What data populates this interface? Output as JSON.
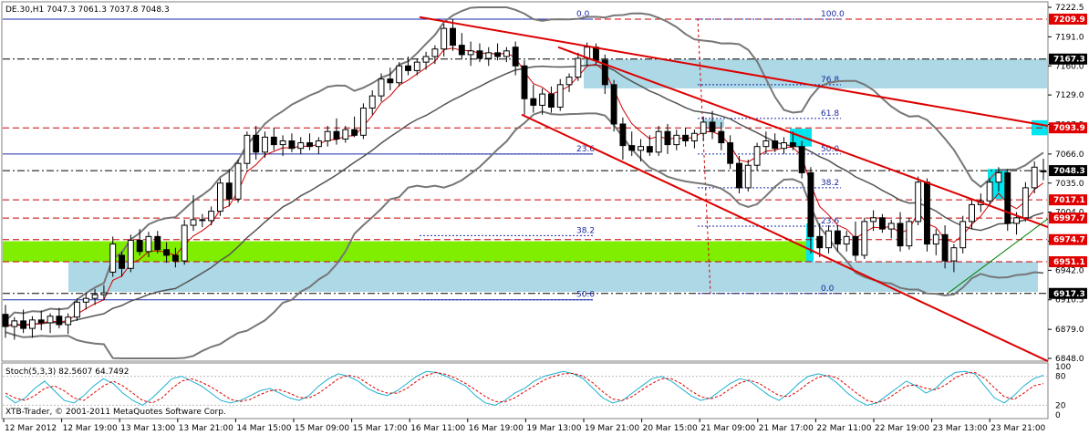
{
  "chart_data": {
    "type": "candlestick",
    "header": "DE.30,H1  7047.3 7061.3 7037.8 7048.3",
    "copyright": "XTB-Trader, © 2001-2011 MetaQuotes Software Corp.",
    "ylim": [
      6848.0,
      7222.5
    ],
    "y_ticks": [
      "7222.5",
      "7191.0",
      "7160.0",
      "7129.0",
      "7097.5",
      "7066.0",
      "7035.0",
      "7004.0",
      "6973.0",
      "6942.0",
      "6910.5",
      "6879.0",
      "6848.0"
    ],
    "x_ticks": [
      "12 Mar 2012",
      "12 Mar 19:00",
      "13 Mar 13:00",
      "13 Mar 21:00",
      "14 Mar 15:00",
      "15 Mar 09:00",
      "15 Mar 17:00",
      "16 Mar 11:00",
      "16 Mar 19:00",
      "19 Mar 13:00",
      "19 Mar 21:00",
      "20 Mar 15:00",
      "21 Mar 09:00",
      "21 Mar 17:00",
      "22 Mar 11:00",
      "22 Mar 19:00",
      "23 Mar 13:00",
      "23 Mar 21:00"
    ],
    "price_tags": [
      {
        "label": "7209.9",
        "value": 7209.9,
        "color": "#e00000"
      },
      {
        "label": "7167.3",
        "value": 7167.3,
        "color": "#000000"
      },
      {
        "label": "7093.9",
        "value": 7093.9,
        "color": "#e00000"
      },
      {
        "label": "7048.3",
        "value": 7048.3,
        "color": "#000000"
      },
      {
        "label": "7017.1",
        "value": 7017.1,
        "color": "#e00000"
      },
      {
        "label": "6997.7",
        "value": 6997.7,
        "color": "#e00000"
      },
      {
        "label": "6974.7",
        "value": 6974.7,
        "color": "#e00000"
      },
      {
        "label": "6951.1",
        "value": 6951.1,
        "color": "#e00000"
      },
      {
        "label": "6917.3",
        "value": 6917.3,
        "color": "#000000"
      }
    ],
    "fib_left": [
      "0.0",
      "23.6",
      "38.2",
      "50.0"
    ],
    "fib_right": [
      "100.0",
      "76.8",
      "61.8",
      "50.0",
      "38.2",
      "23.6",
      "0.0"
    ],
    "stochastic": {
      "label": "Stoch(5,3,3) 82.5607 64.7492",
      "ylim": [
        0,
        100
      ],
      "ticks": [
        "100",
        "80",
        "20",
        "0"
      ],
      "main": [
        40,
        25,
        35,
        55,
        70,
        50,
        30,
        25,
        40,
        60,
        75,
        65,
        45,
        30,
        20,
        35,
        55,
        75,
        80,
        70,
        60,
        45,
        30,
        25,
        30,
        40,
        50,
        55,
        45,
        35,
        30,
        40,
        60,
        75,
        85,
        80,
        70,
        55,
        45,
        40,
        50,
        65,
        80,
        90,
        88,
        80,
        70,
        60,
        40,
        25,
        20,
        30,
        45,
        55,
        70,
        80,
        85,
        90,
        85,
        75,
        55,
        35,
        25,
        30,
        45,
        60,
        75,
        80,
        70,
        55,
        40,
        30,
        35,
        50,
        65,
        75,
        70,
        55,
        40,
        30,
        45,
        65,
        80,
        85,
        80,
        65,
        45,
        30,
        20,
        25,
        40,
        55,
        70,
        60,
        45,
        55,
        75,
        88,
        90,
        85,
        60,
        35,
        25,
        40,
        60,
        75,
        82
      ],
      "signal": [
        45,
        35,
        30,
        40,
        55,
        60,
        50,
        35,
        30,
        45,
        60,
        70,
        60,
        45,
        30,
        25,
        35,
        55,
        70,
        75,
        68,
        58,
        45,
        32,
        28,
        32,
        42,
        50,
        52,
        45,
        36,
        35,
        45,
        60,
        75,
        82,
        78,
        65,
        52,
        45,
        45,
        55,
        70,
        82,
        88,
        84,
        76,
        65,
        52,
        38,
        28,
        27,
        35,
        48,
        60,
        72,
        80,
        85,
        86,
        80,
        66,
        48,
        33,
        30,
        38,
        52,
        65,
        75,
        75,
        65,
        50,
        38,
        33,
        40,
        54,
        66,
        72,
        65,
        52,
        40,
        38,
        50,
        66,
        78,
        82,
        76,
        60,
        44,
        30,
        25,
        32,
        46,
        60,
        62,
        55,
        52,
        62,
        77,
        86,
        88,
        76,
        56,
        38,
        32,
        45,
        60,
        65
      ]
    },
    "candles": [
      {
        "o": 6895,
        "h": 6905,
        "l": 6870,
        "c": 6882
      },
      {
        "o": 6882,
        "h": 6892,
        "l": 6868,
        "c": 6888
      },
      {
        "o": 6888,
        "h": 6900,
        "l": 6875,
        "c": 6880
      },
      {
        "o": 6880,
        "h": 6893,
        "l": 6870,
        "c": 6889
      },
      {
        "o": 6889,
        "h": 6899,
        "l": 6878,
        "c": 6886
      },
      {
        "o": 6886,
        "h": 6896,
        "l": 6875,
        "c": 6893
      },
      {
        "o": 6893,
        "h": 6902,
        "l": 6880,
        "c": 6884
      },
      {
        "o": 6884,
        "h": 6896,
        "l": 6874,
        "c": 6892
      },
      {
        "o": 6892,
        "h": 6912,
        "l": 6888,
        "c": 6908
      },
      {
        "o": 6908,
        "h": 6918,
        "l": 6900,
        "c": 6912
      },
      {
        "o": 6912,
        "h": 6922,
        "l": 6905,
        "c": 6916
      },
      {
        "o": 6916,
        "h": 6926,
        "l": 6910,
        "c": 6918
      },
      {
        "o": 6940,
        "h": 6978,
        "l": 6935,
        "c": 6970
      },
      {
        "o": 6958,
        "h": 6962,
        "l": 6935,
        "c": 6944
      },
      {
        "o": 6944,
        "h": 6980,
        "l": 6940,
        "c": 6974
      },
      {
        "o": 6974,
        "h": 6986,
        "l": 6958,
        "c": 6962
      },
      {
        "o": 6962,
        "h": 6983,
        "l": 6956,
        "c": 6978
      },
      {
        "o": 6978,
        "h": 6984,
        "l": 6960,
        "c": 6964
      },
      {
        "o": 6964,
        "h": 6972,
        "l": 6950,
        "c": 6958
      },
      {
        "o": 6958,
        "h": 6966,
        "l": 6945,
        "c": 6952
      },
      {
        "o": 6952,
        "h": 6996,
        "l": 6948,
        "c": 6990
      },
      {
        "o": 6990,
        "h": 7022,
        "l": 6984,
        "c": 6996
      },
      {
        "o": 6996,
        "h": 7002,
        "l": 6988,
        "c": 6995
      },
      {
        "o": 6995,
        "h": 7010,
        "l": 6990,
        "c": 7005
      },
      {
        "o": 7005,
        "h": 7040,
        "l": 7000,
        "c": 7035
      },
      {
        "o": 7035,
        "h": 7050,
        "l": 7010,
        "c": 7018
      },
      {
        "o": 7018,
        "h": 7060,
        "l": 7014,
        "c": 7056
      },
      {
        "o": 7056,
        "h": 7090,
        "l": 7050,
        "c": 7086
      },
      {
        "o": 7086,
        "h": 7096,
        "l": 7060,
        "c": 7068
      },
      {
        "o": 7068,
        "h": 7090,
        "l": 7062,
        "c": 7084
      },
      {
        "o": 7084,
        "h": 7094,
        "l": 7070,
        "c": 7076
      },
      {
        "o": 7076,
        "h": 7086,
        "l": 7064,
        "c": 7080
      },
      {
        "o": 7080,
        "h": 7088,
        "l": 7068,
        "c": 7072
      },
      {
        "o": 7072,
        "h": 7084,
        "l": 7066,
        "c": 7078
      },
      {
        "o": 7078,
        "h": 7088,
        "l": 7070,
        "c": 7074
      },
      {
        "o": 7074,
        "h": 7084,
        "l": 7066,
        "c": 7080
      },
      {
        "o": 7080,
        "h": 7096,
        "l": 7074,
        "c": 7090
      },
      {
        "o": 7090,
        "h": 7104,
        "l": 7076,
        "c": 7082
      },
      {
        "o": 7082,
        "h": 7096,
        "l": 7078,
        "c": 7092
      },
      {
        "o": 7092,
        "h": 7106,
        "l": 7084,
        "c": 7086
      },
      {
        "o": 7086,
        "h": 7120,
        "l": 7082,
        "c": 7115
      },
      {
        "o": 7115,
        "h": 7134,
        "l": 7108,
        "c": 7128
      },
      {
        "o": 7128,
        "h": 7152,
        "l": 7122,
        "c": 7146
      },
      {
        "o": 7146,
        "h": 7158,
        "l": 7134,
        "c": 7142
      },
      {
        "o": 7142,
        "h": 7164,
        "l": 7138,
        "c": 7160
      },
      {
        "o": 7160,
        "h": 7170,
        "l": 7150,
        "c": 7155
      },
      {
        "o": 7155,
        "h": 7168,
        "l": 7150,
        "c": 7164
      },
      {
        "o": 7164,
        "h": 7175,
        "l": 7156,
        "c": 7170
      },
      {
        "o": 7170,
        "h": 7182,
        "l": 7162,
        "c": 7178
      },
      {
        "o": 7178,
        "h": 7205,
        "l": 7170,
        "c": 7200
      },
      {
        "o": 7200,
        "h": 7210,
        "l": 7176,
        "c": 7182
      },
      {
        "o": 7182,
        "h": 7195,
        "l": 7168,
        "c": 7172
      },
      {
        "o": 7172,
        "h": 7186,
        "l": 7160,
        "c": 7176
      },
      {
        "o": 7176,
        "h": 7184,
        "l": 7164,
        "c": 7168
      },
      {
        "o": 7168,
        "h": 7180,
        "l": 7160,
        "c": 7174
      },
      {
        "o": 7174,
        "h": 7184,
        "l": 7166,
        "c": 7170
      },
      {
        "o": 7170,
        "h": 7180,
        "l": 7164,
        "c": 7176
      },
      {
        "o": 7180,
        "h": 7186,
        "l": 7150,
        "c": 7160
      },
      {
        "o": 7160,
        "h": 7166,
        "l": 7108,
        "c": 7125
      },
      {
        "o": 7125,
        "h": 7140,
        "l": 7110,
        "c": 7118
      },
      {
        "o": 7118,
        "h": 7136,
        "l": 7108,
        "c": 7130
      },
      {
        "o": 7130,
        "h": 7138,
        "l": 7110,
        "c": 7116
      },
      {
        "o": 7116,
        "h": 7146,
        "l": 7112,
        "c": 7140
      },
      {
        "o": 7140,
        "h": 7152,
        "l": 7132,
        "c": 7148
      },
      {
        "o": 7148,
        "h": 7174,
        "l": 7144,
        "c": 7168
      },
      {
        "o": 7168,
        "h": 7185,
        "l": 7160,
        "c": 7180
      },
      {
        "o": 7180,
        "h": 7184,
        "l": 7162,
        "c": 7166
      },
      {
        "o": 7166,
        "h": 7172,
        "l": 7130,
        "c": 7140
      },
      {
        "o": 7140,
        "h": 7145,
        "l": 7090,
        "c": 7098
      },
      {
        "o": 7098,
        "h": 7105,
        "l": 7060,
        "c": 7075
      },
      {
        "o": 7075,
        "h": 7090,
        "l": 7064,
        "c": 7070
      },
      {
        "o": 7070,
        "h": 7082,
        "l": 7058,
        "c": 7074
      },
      {
        "o": 7074,
        "h": 7086,
        "l": 7064,
        "c": 7068
      },
      {
        "o": 7068,
        "h": 7096,
        "l": 7064,
        "c": 7090
      },
      {
        "o": 7090,
        "h": 7098,
        "l": 7066,
        "c": 7076
      },
      {
        "o": 7076,
        "h": 7092,
        "l": 7070,
        "c": 7086
      },
      {
        "o": 7086,
        "h": 7094,
        "l": 7074,
        "c": 7080
      },
      {
        "o": 7080,
        "h": 7092,
        "l": 7072,
        "c": 7088
      },
      {
        "o": 7088,
        "h": 7106,
        "l": 7080,
        "c": 7100
      },
      {
        "o": 7100,
        "h": 7112,
        "l": 7082,
        "c": 7090
      },
      {
        "o": 7090,
        "h": 7100,
        "l": 7070,
        "c": 7078
      },
      {
        "o": 7078,
        "h": 7086,
        "l": 7050,
        "c": 7056
      },
      {
        "o": 7056,
        "h": 7064,
        "l": 7024,
        "c": 7030
      },
      {
        "o": 7030,
        "h": 7060,
        "l": 7026,
        "c": 7054
      },
      {
        "o": 7054,
        "h": 7078,
        "l": 7048,
        "c": 7074
      },
      {
        "o": 7074,
        "h": 7090,
        "l": 7066,
        "c": 7080
      },
      {
        "o": 7080,
        "h": 7088,
        "l": 7068,
        "c": 7072
      },
      {
        "o": 7072,
        "h": 7084,
        "l": 7066,
        "c": 7078
      },
      {
        "o": 7078,
        "h": 7090,
        "l": 7070,
        "c": 7074
      },
      {
        "o": 7074,
        "h": 7080,
        "l": 7040,
        "c": 7046
      },
      {
        "o": 7046,
        "h": 7052,
        "l": 6960,
        "c": 6978
      },
      {
        "o": 6978,
        "h": 6992,
        "l": 6956,
        "c": 6966
      },
      {
        "o": 6966,
        "h": 6990,
        "l": 6960,
        "c": 6984
      },
      {
        "o": 6984,
        "h": 6990,
        "l": 6962,
        "c": 6970
      },
      {
        "o": 6970,
        "h": 6984,
        "l": 6962,
        "c": 6978
      },
      {
        "o": 6978,
        "h": 6994,
        "l": 6952,
        "c": 6958
      },
      {
        "o": 6958,
        "h": 6998,
        "l": 6954,
        "c": 6994
      },
      {
        "o": 6994,
        "h": 7006,
        "l": 6984,
        "c": 6998
      },
      {
        "o": 6998,
        "h": 7002,
        "l": 6982,
        "c": 6986
      },
      {
        "o": 6986,
        "h": 6996,
        "l": 6976,
        "c": 6992
      },
      {
        "o": 6992,
        "h": 7004,
        "l": 6962,
        "c": 6968
      },
      {
        "o": 6968,
        "h": 6998,
        "l": 6964,
        "c": 6994
      },
      {
        "o": 6994,
        "h": 7042,
        "l": 6990,
        "c": 7036
      },
      {
        "o": 7036,
        "h": 7040,
        "l": 6962,
        "c": 6970
      },
      {
        "o": 6970,
        "h": 6986,
        "l": 6958,
        "c": 6980
      },
      {
        "o": 6980,
        "h": 6990,
        "l": 6944,
        "c": 6952
      },
      {
        "o": 6952,
        "h": 6970,
        "l": 6940,
        "c": 6966
      },
      {
        "o": 6966,
        "h": 7000,
        "l": 6960,
        "c": 6994
      },
      {
        "o": 6994,
        "h": 7018,
        "l": 6986,
        "c": 7012
      },
      {
        "o": 7012,
        "h": 7024,
        "l": 7004,
        "c": 7016
      },
      {
        "o": 7016,
        "h": 7040,
        "l": 7010,
        "c": 7036
      },
      {
        "o": 7036,
        "h": 7052,
        "l": 7026,
        "c": 7046
      },
      {
        "o": 7046,
        "h": 7050,
        "l": 6984,
        "c": 6992
      },
      {
        "o": 6992,
        "h": 7004,
        "l": 6980,
        "c": 6998
      },
      {
        "o": 6998,
        "h": 7036,
        "l": 6994,
        "c": 7030
      },
      {
        "o": 7030,
        "h": 7058,
        "l": 7024,
        "c": 7052
      },
      {
        "o": 7047,
        "h": 7061,
        "l": 7038,
        "c": 7048
      }
    ]
  }
}
